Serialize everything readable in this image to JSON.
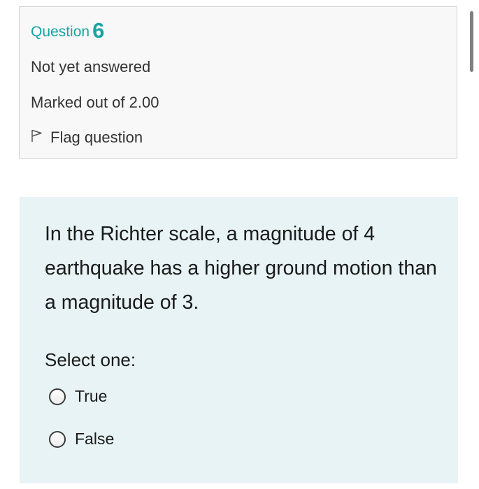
{
  "info": {
    "question_label": "Question",
    "question_number": "6",
    "state": "Not yet answered",
    "grade": "Marked out of 2.00",
    "flag_label": "Flag question"
  },
  "question": {
    "text": "In the Richter scale, a magnitude of 4 earthquake has a higher ground motion than a magnitude of 3.",
    "prompt": "Select one:",
    "options": [
      {
        "label": "True",
        "selected": false
      },
      {
        "label": "False",
        "selected": false
      }
    ]
  },
  "colors": {
    "accent": "#1aa3a3",
    "content_bg": "#e7f3f5",
    "info_bg": "#f8f8f8",
    "border": "#d2d2d2"
  },
  "icons": {
    "flag": "flag-outline-icon",
    "radio": "radio-unchecked-icon"
  }
}
